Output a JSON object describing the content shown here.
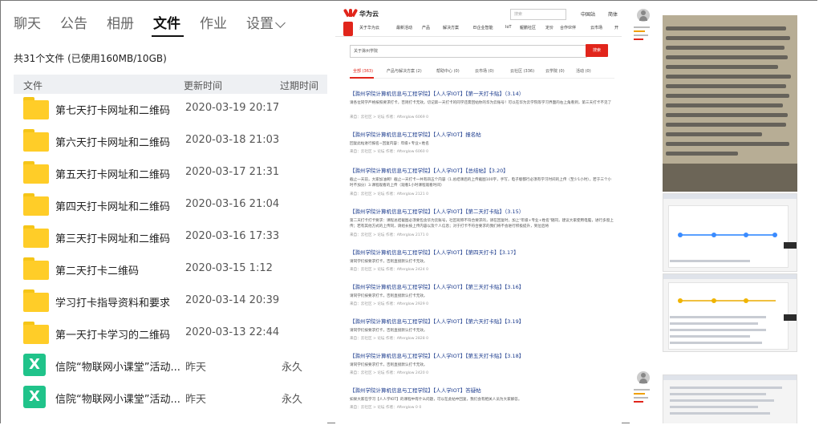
{
  "tabs": [
    "聊天",
    "公告",
    "相册",
    "文件",
    "作业",
    "设置"
  ],
  "summary": "共31个文件 (已使用160MB/10GB)",
  "columns": {
    "name": "文件",
    "time": "更新时间",
    "expire": "过期时间"
  },
  "files": [
    {
      "name": "第七天打卡网址和二维码",
      "time": "2020-03-19 20:17",
      "expire": "",
      "type": "folder"
    },
    {
      "name": "第六天打卡网址和二维码",
      "time": "2020-03-18 21:03",
      "expire": "",
      "type": "folder"
    },
    {
      "name": "第五天打卡网址和二维码",
      "time": "2020-03-17 21:31",
      "expire": "",
      "type": "folder"
    },
    {
      "name": "第四天打卡网址和二维码",
      "time": "2020-03-16 21:04",
      "expire": "",
      "type": "folder"
    },
    {
      "name": "第三天打卡网址和二维码",
      "time": "2020-03-16 17:33",
      "expire": "",
      "type": "folder"
    },
    {
      "name": "第二天打卡二维码",
      "time": "2020-03-15 1:12",
      "expire": "",
      "type": "folder"
    },
    {
      "name": "学习打卡指导资料和要求",
      "time": "2020-03-14 20:39",
      "expire": "",
      "type": "folder"
    },
    {
      "name": "第一天打卡学习的二维码",
      "time": "2020-03-13 22:44",
      "expire": "",
      "type": "folder"
    },
    {
      "name": "信院“物联网小课堂”活动...",
      "time": "昨天",
      "expire": "永久",
      "type": "excel"
    },
    {
      "name": "信院“物联网小课堂”活动...",
      "time": "昨天",
      "expire": "永久",
      "type": "excel"
    }
  ],
  "huawei": {
    "brand": "华为云",
    "search_placeholder": "搜索",
    "region": "中国站",
    "region2": "简体",
    "nav": [
      "关于华为云",
      "最新活动",
      "产品",
      "解决方案",
      "EI企业智能",
      "IoT",
      "鲲鹏社区",
      "定价",
      "合作伙伴",
      "云市场",
      "开"
    ],
    "query": "关于滁州学院",
    "search_button": "搜索",
    "result_tabs": [
      "全部 (363)",
      "产品与解决方案 (2)",
      "帮助中心 (0)",
      "云市场 (0)",
      "云社区 (336)",
      "云学院 (0)",
      "活动 (0)"
    ],
    "results": [
      {
        "title": "【滁州学院计算机信息与工程学院】【人人学IOT】【第一天打卡贴】（3.14）",
        "desc": "请各位同学严格按照要求打卡，否则打卡无效。切记第一天打卡的同学还需回帖你的华为云账号！可以在华为云学院等学习界面的右上角看到，第三天打卡不见了",
        "meta": "来自：云社区 > 论坛    作者：Afterglow    6069    0"
      },
      {
        "title": "【滁州学院计算机信息与工程学院】【人人学IOT】报名帖",
        "desc": "回复此帖进行报名~回复内容：年级+专业+姓名",
        "meta": "来自：云社区 > 论坛    作者：Afterglow    6060    0"
      },
      {
        "title": "【滁州学院计算机信息与工程学院】【人人学IOT】【总结帖】【3.20】",
        "desc": "截止一天前，大家加油啊！截止一天打卡一共有四五个内容（1.总结课后的上传截图100字，手写，电子版都行必须有学习时间的上传（至少1小时），若于三个小时不加分）3.课程观看的上传（观看1小时课程观看时间）",
        "meta": "来自：云社区 > 论坛    作者：Afterglow    2121    0"
      },
      {
        "title": "【滁州学院计算机信息与工程学院】【人人学IOT】【第二天打卡贴】（3.15）",
        "desc": "第二天打卡打卡要求：课程总结截图必须要包含华为云账号，社区昵称不符合要求的，请在回复时，加上\"年级+专业+姓名\"随同，建议大家使用电脑，进行多窗上传；若有其他方式的上传同，请组长按上传内容以及个人信息；对于打卡不符合要求的我们将不会进行积极提升，到位后将",
        "meta": "来自：云社区 > 论坛    作者：Afterglow    2171    0"
      },
      {
        "title": "【滁州学院计算机信息与工程学院】【人人学IOT】【第四天打卡】【3.17】",
        "desc": "请同学们按要求打卡，否则直接默认打卡无效。",
        "meta": "来自：云社区 > 论坛    作者：Afterglow    2424    0"
      },
      {
        "title": "【滁州学院计算机信息与工程学院】【人人学IOT】【第三天打卡贴】【3.16】",
        "desc": "请同学们按要求打卡，否则直接默认打卡无效。",
        "meta": "来自：云社区 > 论坛    作者：Afterglow    2929    0"
      },
      {
        "title": "【滁州学院计算机信息与工程学院】【人人学IOT】【第六天打卡贴】【3.19】",
        "desc": "请同学们按要求打卡，否则直接默认打卡无效。",
        "meta": "来自：云社区 > 论坛    作者：Afterglow    2828    0"
      },
      {
        "title": "【滁州学院计算机信息与工程学院】【人人学IOT】【第五天打卡贴】【3.18】",
        "desc": "请同学们按要求打卡，否则直接默认打卡无效。",
        "meta": "来自：云社区 > 论坛    作者：Afterglow    2420    0"
      },
      {
        "title": "【滁州学院计算机信息与工程学院】【人人学IOT】答疑帖",
        "desc": "如果大家在学习【人人学IOT】的课程中有什么问题，可以在此帖中回复，我们会有相关人员为大家解答。",
        "meta": "来自：云社区 > 论坛    作者：Afterglow    0    0"
      }
    ]
  },
  "colors": {
    "accent": "#e1251b",
    "link": "#1a3a8c",
    "folder": "#ffcd28",
    "excel": "#20c38a"
  }
}
